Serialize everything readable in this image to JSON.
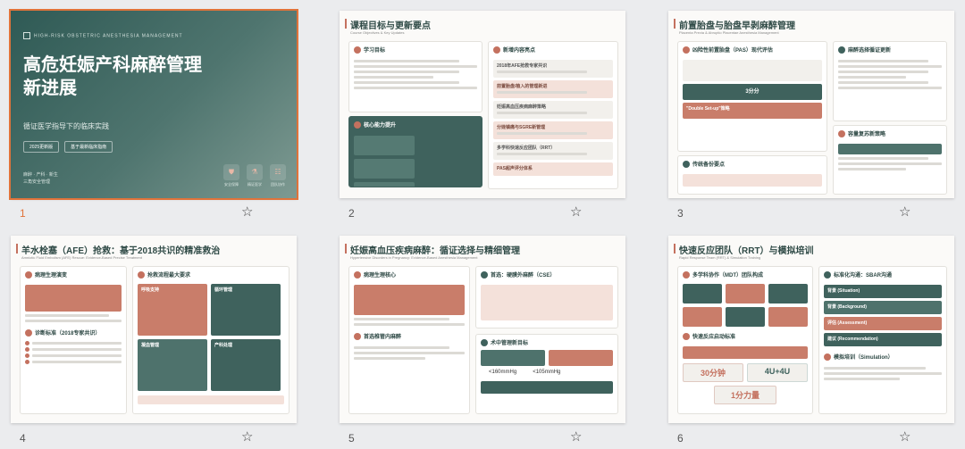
{
  "slides": [
    {
      "number": "1",
      "kicker": "HIGH-RISK OBSTETRIC ANESTHESIA MANAGEMENT",
      "title": "高危妊娠产科麻醉管理新进展",
      "subtitle": "循证医学指导下的临床实践",
      "tags": [
        "2025更新版",
        "基于最新临床指南"
      ],
      "author_line1": "麻醉 · 产科 · 新生",
      "author_line2": "三角安全管理",
      "buttons": [
        "安全保障",
        "精证医学",
        "团队协作"
      ]
    },
    {
      "number": "2",
      "title": "课程目标与更新要点",
      "subtitle": "Course Objectives & Key Updates",
      "left_heading": "学习目标",
      "right_heading": "新增内容亮点",
      "right_items": [
        "2018年AFE抢救专家共识",
        "前置胎盘/植入的管理新进",
        "妊娠高血压疾病麻醉策略",
        "分娩镇痛与SGRE新管理",
        "多学科快速反应团队（RRT）",
        "PAS超声评分体系"
      ],
      "core_heading": "核心能力提升"
    },
    {
      "number": "3",
      "title": "前置胎盘与胎盘早剥麻醉管理",
      "subtitle": "Placenta Previa & Abruptio Placentae Anesthesia Management",
      "left_heading": "凶险性前置胎盘（PAS）现代评估",
      "score_label": "3分分",
      "banner": "\"Double Set-up\"策略",
      "left_heading2": "传统备份要点",
      "right_heading": "麻醉选择循证更新",
      "right_heading2": "容量复苏新策略"
    },
    {
      "number": "4",
      "title": "羊水栓塞（AFE）抢救：基于2018共识的精准救治",
      "subtitle": "Amniotic Fluid Embolism (AFE) Rescue: Evidence-Based Precise Treatment",
      "left_heading": "病理生理演变",
      "left_heading2": "诊断标准（2018专家共识）",
      "right_heading": "抢救流程最大要求",
      "tiles": [
        "呼吸支持",
        "循环管理",
        "凝血管理",
        "产科处理"
      ]
    },
    {
      "number": "5",
      "title": "妊娠高血压疾病麻醉：循证选择与精细管理",
      "subtitle": "Hypertensive Disorders in Pregnancy: Evidence-Based Anesthesia Management",
      "left_heading": "病理生理核心",
      "left_heading2": "首选椎管内麻醉",
      "right_heading": "首选：硬膜外麻醉（CSE）",
      "right_heading2": "术中管理新目标",
      "bp1": "<160mmHg",
      "bp2": "<105mmHg"
    },
    {
      "number": "6",
      "title": "快速反应团队（RRT）与模拟培训",
      "subtitle": "Rapid Response Team (RRT) & Simulation Training",
      "left_heading": "多学科协作（MDT）团队构成",
      "left_heading2": "快速反应启动标准",
      "stats": [
        "30分钟",
        "4U+4U",
        "1分力量"
      ],
      "right_heading": "标准化沟通：SBAR沟通",
      "sbar": [
        "背景 (Situation)",
        "背景 (Background)",
        "评估 (Assessment)",
        "建议 (Recommendation)"
      ],
      "right_heading2": "模拟培训（Simulation）"
    }
  ],
  "colors": {
    "accent": "#c4715f",
    "teal": "#3f625d",
    "selected_outline": "#e0733a"
  },
  "icons": {
    "favorite": "star-outline-icon"
  },
  "selected_slide": "1"
}
